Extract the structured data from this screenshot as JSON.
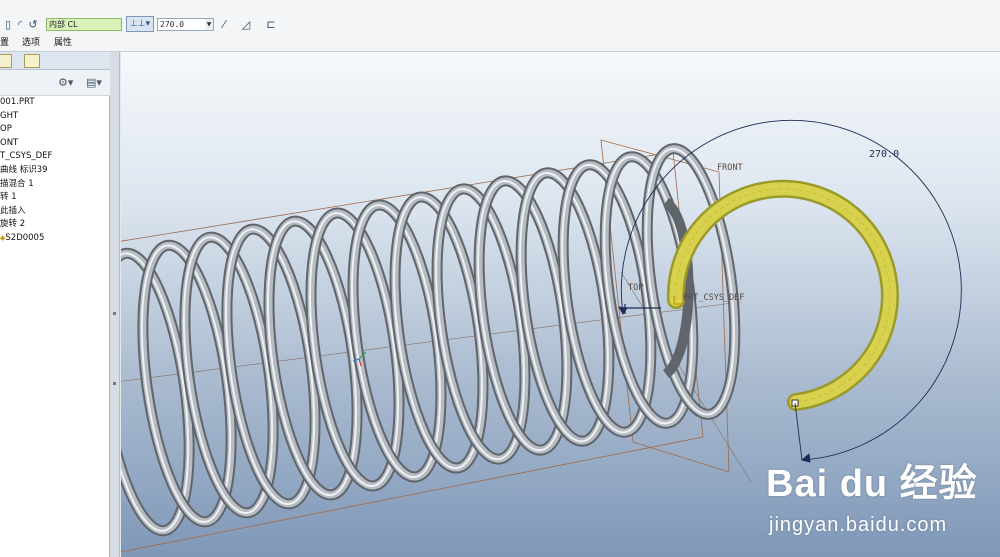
{
  "dashboard": {
    "row1": {
      "datum_ref": "内部 CL",
      "angle_value": "270.0"
    },
    "menu": [
      "置",
      "选项",
      "属性"
    ]
  },
  "model_tree": {
    "items": [
      {
        "label": "001.PRT"
      },
      {
        "label": "GHT"
      },
      {
        "label": "OP"
      },
      {
        "label": "ONT"
      },
      {
        "label": "T_CSYS_DEF"
      },
      {
        "label": "曲线 标识39"
      },
      {
        "label": "描混合 1"
      },
      {
        "label": "转 1"
      },
      {
        "label": "此插入"
      },
      {
        "label": "旋转 2"
      },
      {
        "label": "S2D0005",
        "insert_icon": "◆"
      }
    ]
  },
  "graphics": {
    "datum_labels": {
      "front": "FRONT",
      "top": "TOP",
      "csys": "PRT_CSYS_DEF"
    },
    "dimension": "270.0",
    "colors": {
      "spring": "#b7bcc3",
      "sweep_section": "#d8d14e",
      "dimension_line": "#1d2a55",
      "datum_plane": "#a06a4a"
    }
  },
  "watermark": {
    "logo": "Bai du 经验",
    "url": "jingyan.baidu.com"
  }
}
